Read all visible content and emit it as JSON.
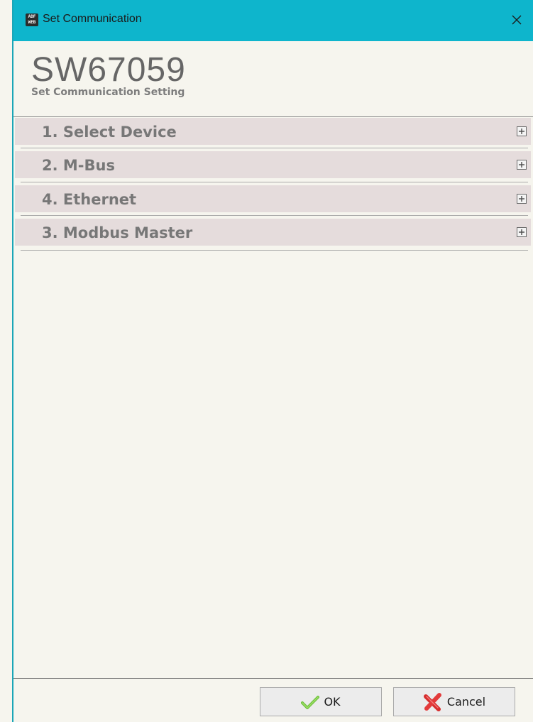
{
  "window": {
    "title": "Set Communication",
    "icon_text_top": "ADF",
    "icon_text_bottom": "WEB",
    "close_icon": "close-icon",
    "accent_color": "#0eb5cc"
  },
  "header": {
    "product_code": "SW67059",
    "subtitle": "Set Communication Setting"
  },
  "sections": [
    {
      "label": "1. Select Device",
      "icon": "expand-plus-icon",
      "expanded": false
    },
    {
      "label": "2. M-Bus",
      "icon": "expand-plus-icon",
      "expanded": false
    },
    {
      "label": "4. Ethernet",
      "icon": "expand-plus-icon",
      "expanded": false
    },
    {
      "label": "3. Modbus Master",
      "icon": "expand-plus-icon",
      "expanded": false
    }
  ],
  "footer": {
    "ok_label": "OK",
    "ok_icon": "checkmark-icon",
    "cancel_label": "Cancel",
    "cancel_icon": "cross-icon"
  }
}
